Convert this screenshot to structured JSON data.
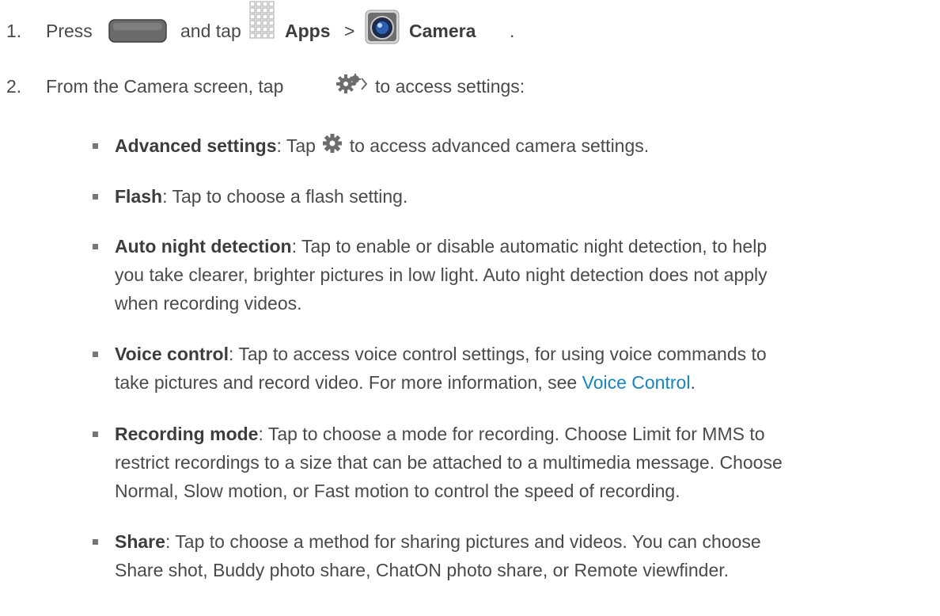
{
  "step1": {
    "number": "1.",
    "press": "Press",
    "and_tap": "and tap",
    "apps": "Apps",
    "gt": ">",
    "camera": "Camera",
    "end": "."
  },
  "step2": {
    "number": "2.",
    "text_before": "From the Camera screen, tap",
    "text_after": "to access settings:"
  },
  "bullets": {
    "advanced": {
      "term": "Advanced settings",
      "sep": ": Tap",
      "rest": "to access advanced camera settings."
    },
    "flash": {
      "term": "Flash",
      "rest": ": Tap to choose a flash setting."
    },
    "night": {
      "term": "Auto night detection",
      "line1": ": Tap to enable or disable automatic night detection, to help",
      "line2": "you take clearer, brighter pictures in low light. Auto night detection does not apply",
      "line3": "when recording videos."
    },
    "voice": {
      "term": "Voice control",
      "line1": ": Tap to access voice control settings, for using voice commands to",
      "line2": "take pictures and record video. For more information, see",
      "link": "Voice Control",
      "end": "."
    },
    "recording": {
      "term": "Recording mode",
      "line1": ": Tap to choose a mode for recording. Choose Limit for MMS to",
      "line2": "restrict recordings to a size that can be attached to a multimedia message. Choose",
      "line3": "Normal, Slow motion, or Fast motion to control the speed of recording."
    },
    "share": {
      "term": "Share",
      "line1": ": Tap to choose a method for sharing pictures and videos. You can choose",
      "line2": "Share shot, Buddy photo share, ChatON photo share, or Remote viewfinder."
    }
  },
  "colors": {
    "text": "#4a4a4a",
    "link": "#1a84b8",
    "bullet": "#777777"
  },
  "icons": [
    "home-key-icon",
    "apps-grid-icon",
    "camera-app-icon",
    "settings-expand-icon",
    "gear-icon"
  ]
}
